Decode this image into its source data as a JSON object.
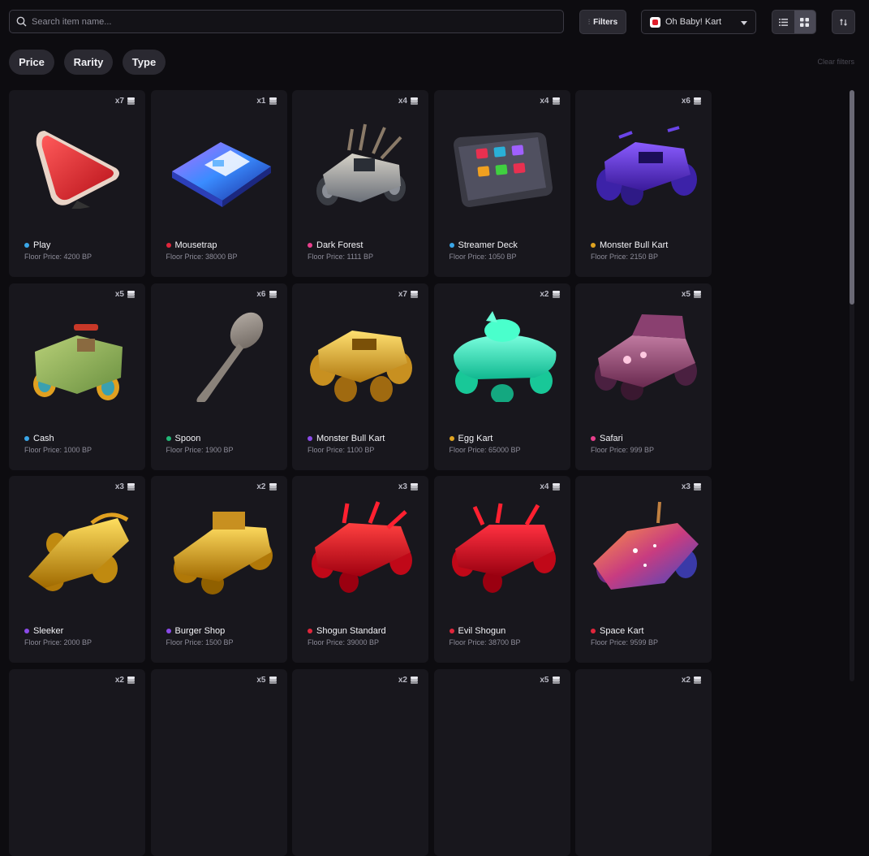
{
  "search": {
    "placeholder": "Search item name..."
  },
  "toolbar": {
    "filters_label": "Filters",
    "game_selected": "Oh Baby! Kart",
    "clear_filters": "Clear filters"
  },
  "pills": [
    "Price",
    "Rarity",
    "Type"
  ],
  "items": [
    {
      "name": "Play",
      "price": "Floor Price: 4200 BP",
      "count": "x7",
      "dot": "#3aa6e8",
      "art": "play"
    },
    {
      "name": "Mousetrap",
      "price": "Floor Price: 38000 BP",
      "count": "x1",
      "dot": "#e0263b",
      "art": "mousetrap"
    },
    {
      "name": "Dark Forest",
      "price": "Floor Price: 1111 BP",
      "count": "x4",
      "dot": "#e83f8c",
      "art": "darkforest"
    },
    {
      "name": "Streamer Deck",
      "price": "Floor Price: 1050 BP",
      "count": "x4",
      "dot": "#3aa6e8",
      "art": "deck"
    },
    {
      "name": "Monster Bull Kart",
      "price": "Floor Price: 2150 BP",
      "count": "x6",
      "dot": "#e0a320",
      "art": "purplekart"
    },
    {
      "name": "Cash",
      "price": "Floor Price: 1000 BP",
      "count": "x5",
      "dot": "#3aa6e8",
      "art": "cash"
    },
    {
      "name": "Spoon",
      "price": "Floor Price: 1900 BP",
      "count": "x6",
      "dot": "#22b877",
      "art": "spoon"
    },
    {
      "name": "Monster Bull Kart",
      "price": "Floor Price: 1100 BP",
      "count": "x7",
      "dot": "#8a4ae8",
      "art": "goldkart"
    },
    {
      "name": "Egg Kart",
      "price": "Floor Price: 65000 BP",
      "count": "x2",
      "dot": "#e0a320",
      "art": "eggkart"
    },
    {
      "name": "Safari",
      "price": "Floor Price: 999 BP",
      "count": "x5",
      "dot": "#e83f8c",
      "art": "safari"
    },
    {
      "name": "Sleeker",
      "price": "Floor Price: 2000 BP",
      "count": "x3",
      "dot": "#8a4ae8",
      "art": "sleeker"
    },
    {
      "name": "Burger Shop",
      "price": "Floor Price: 1500 BP",
      "count": "x2",
      "dot": "#8a4ae8",
      "art": "burger"
    },
    {
      "name": "Shogun Standard",
      "price": "Floor Price: 39000 BP",
      "count": "x3",
      "dot": "#e0263b",
      "art": "redkart"
    },
    {
      "name": "Evil Shogun",
      "price": "Floor Price: 38700 BP",
      "count": "x4",
      "dot": "#e0263b",
      "art": "redkart2"
    },
    {
      "name": "Space Kart",
      "price": "Floor Price: 9599 BP",
      "count": "x3",
      "dot": "#e0263b",
      "art": "spacekart"
    },
    {
      "name": "",
      "price": "",
      "count": "x2",
      "dot": "",
      "art": "none"
    },
    {
      "name": "",
      "price": "",
      "count": "x5",
      "dot": "",
      "art": "none"
    },
    {
      "name": "",
      "price": "",
      "count": "x2",
      "dot": "",
      "art": "none"
    },
    {
      "name": "",
      "price": "",
      "count": "x5",
      "dot": "",
      "art": "none"
    },
    {
      "name": "",
      "price": "",
      "count": "x2",
      "dot": "",
      "art": "none"
    }
  ]
}
